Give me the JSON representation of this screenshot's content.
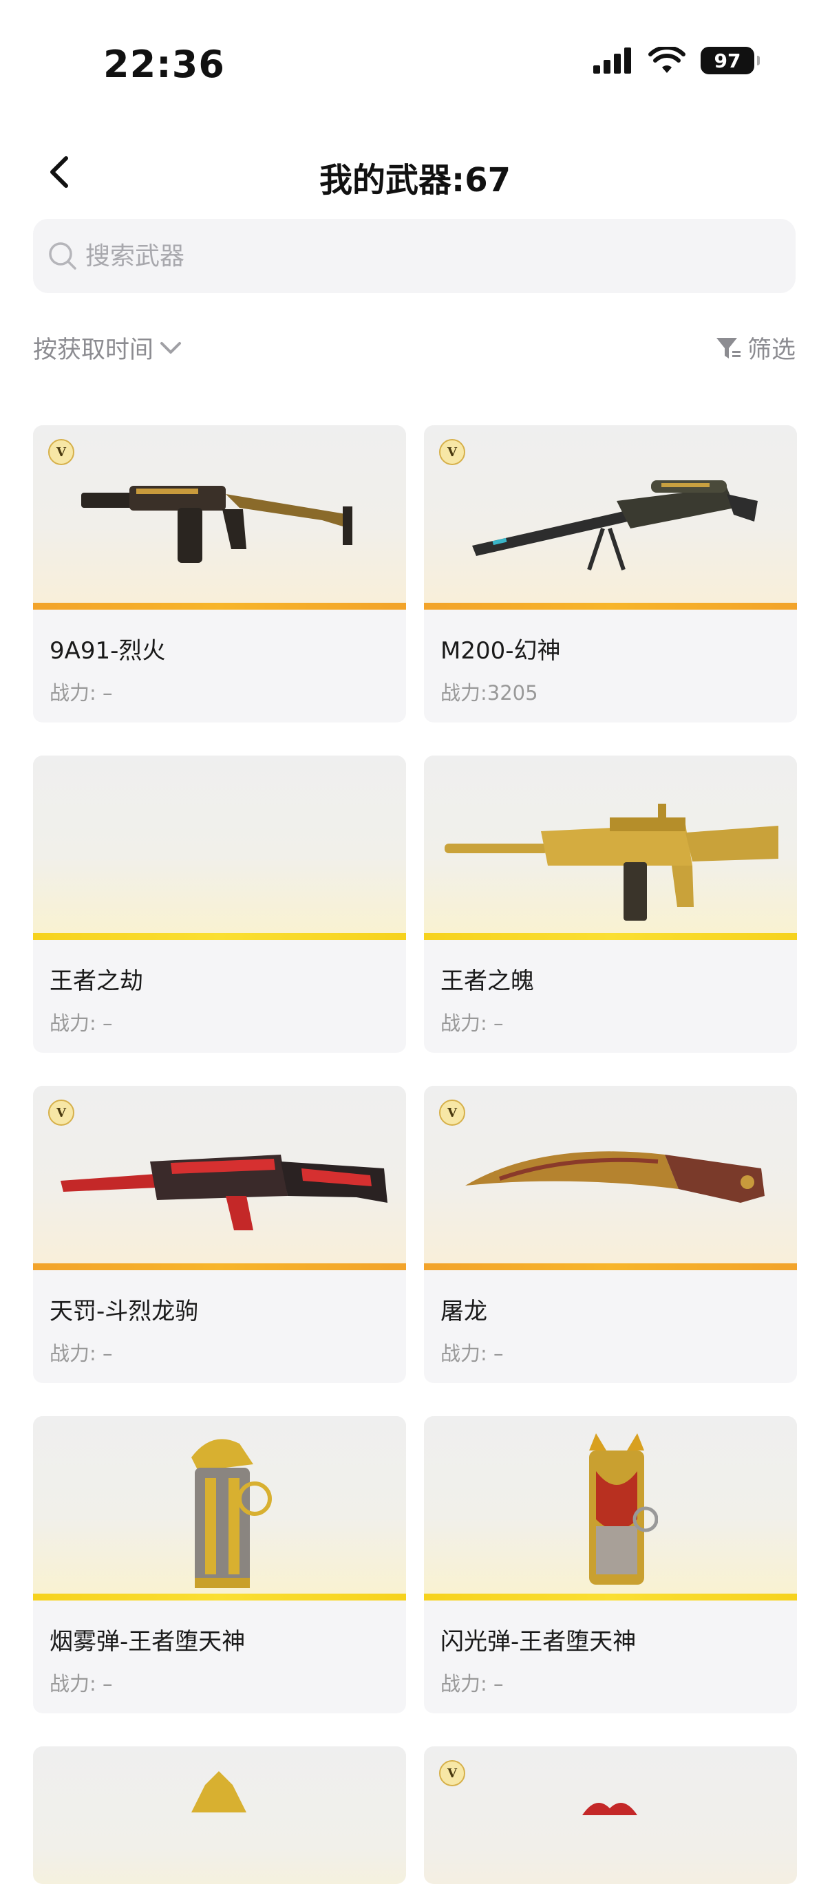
{
  "status_bar": {
    "time": "22:36",
    "battery": "97"
  },
  "header": {
    "title": "我的武器:67"
  },
  "search": {
    "placeholder": "搜索武器"
  },
  "toolbar": {
    "sort_label": "按获取时间",
    "filter_label": "筛选"
  },
  "colors": {
    "accent_orange": "#F5A623",
    "accent_yellow": "#F7D51D",
    "text_secondary": "#999999"
  },
  "weapons": [
    {
      "name": "9A91-烈火",
      "power": "战力: –",
      "badge": "V"
    },
    {
      "name": "M200-幻神",
      "power": "战力:3205",
      "badge": "V"
    },
    {
      "name": "王者之劫",
      "power": "战力: –"
    },
    {
      "name": "王者之魄",
      "power": "战力: –"
    },
    {
      "name": "天罚-斗烈龙驹",
      "power": "战力: –",
      "badge": "V"
    },
    {
      "name": "屠龙",
      "power": "战力: –",
      "badge": "V"
    },
    {
      "name": "烟雾弹-王者堕天神",
      "power": "战力: –"
    },
    {
      "name": "闪光弹-王者堕天神",
      "power": "战力: –"
    }
  ],
  "partial_cards": [
    {
      "badge": ""
    },
    {
      "badge": "V"
    }
  ]
}
